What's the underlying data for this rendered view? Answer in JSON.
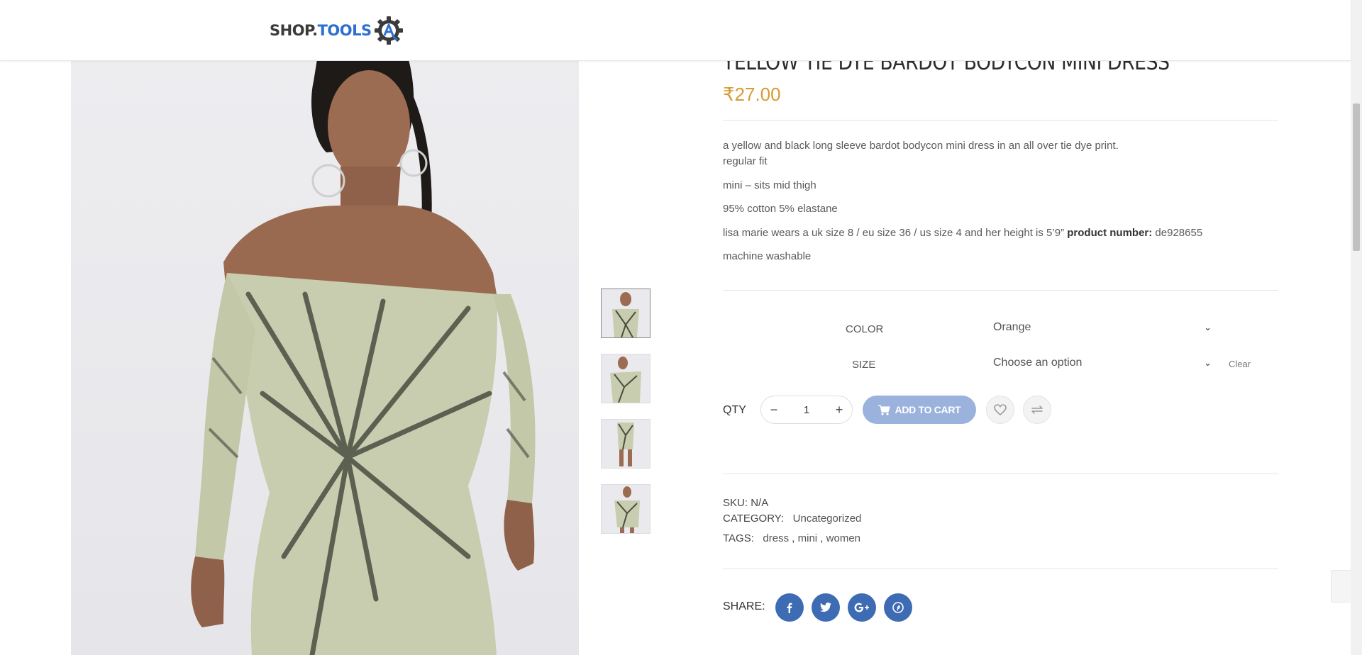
{
  "header": {
    "logo_text_shop": "SHOP.",
    "logo_text_tools": "TOOLS",
    "logo_gear_letter": "A"
  },
  "product": {
    "title": "YELLOW TIE DYE BARDOT BODYCON MINI DRESS",
    "price": "₹27.00",
    "description": {
      "line1": "a yellow and black long sleeve bardot bodycon mini dress in an all over tie dye print.",
      "line2": "regular fit",
      "line3": "mini – sits mid thigh",
      "line4": "95% cotton 5% elastane",
      "line5_text": "lisa marie wears a uk size 8 / eu size 36 / us size 4 and her height is 5’9”",
      "line5_bold": "product number:",
      "line5_value": "de928655",
      "line6": "machine washable"
    },
    "variations": {
      "color_label": "COLOR",
      "color_value": "Orange",
      "size_label": "SIZE",
      "size_value": "Choose an option",
      "clear_label": "Clear"
    },
    "qty_label": "QTY",
    "qty_value": "1",
    "minus_symbol": "−",
    "plus_symbol": "+",
    "add_to_cart_label": "ADD TO CART",
    "sku_label": "SKU:",
    "sku_value": "N/A",
    "category_label": "CATEGORY:",
    "category_value": "Uncategorized",
    "tags_label": "TAGS:",
    "tags": [
      "dress",
      "mini",
      "women"
    ],
    "share_label": "SHARE:"
  },
  "colors": {
    "price": "#d59b34",
    "accent": "#3d6bb4",
    "add_to_cart_bg": "#9bb2dd",
    "logo_blue": "#2e6fd0"
  },
  "icons": {
    "wishlist": "wishlist-heart-icon",
    "compare": "compare-arrows-icon",
    "cart": "cart-icon",
    "share": [
      "facebook-icon",
      "twitter-icon",
      "google-plus-icon",
      "pinterest-icon"
    ]
  }
}
